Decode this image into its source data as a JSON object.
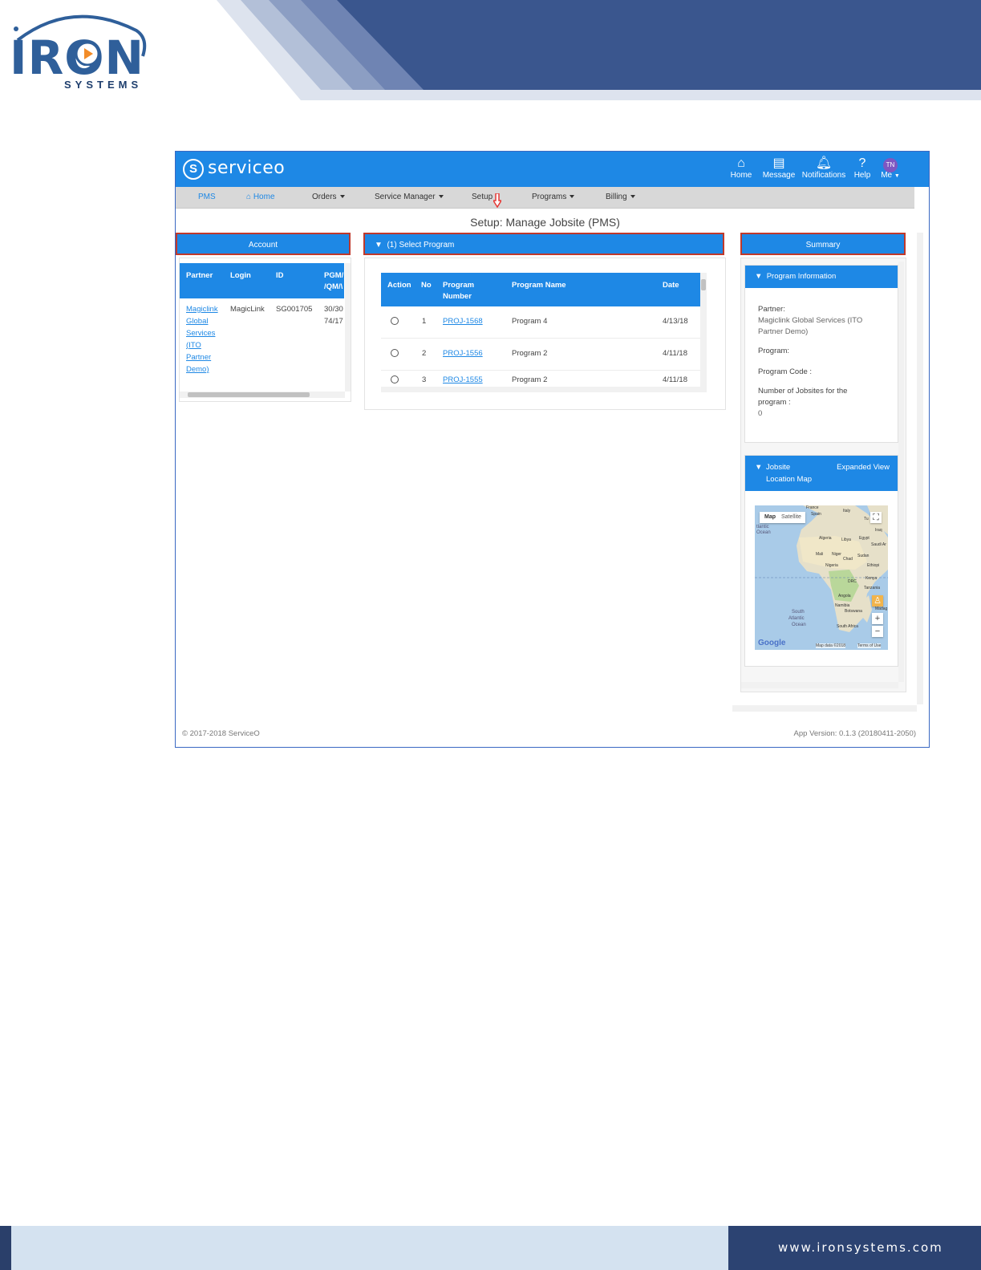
{
  "document": {
    "logo_text": "IRON",
    "logo_subtext": "SYSTEMS",
    "footer_url": "www.ironsystems.com",
    "colors": {
      "navy": "#2c4372",
      "brand_blue": "#1e88e5",
      "light_blue": "#d4e2f0"
    }
  },
  "topbar": {
    "brand": "serviceo",
    "items": [
      {
        "label": "Home",
        "icon": "home-icon"
      },
      {
        "label": "Message",
        "icon": "message-icon"
      },
      {
        "label": "Notifications",
        "icon": "bell-icon"
      },
      {
        "label": "Help",
        "icon": "help-icon"
      },
      {
        "label": "Me",
        "icon": "avatar",
        "initials": "TN"
      }
    ]
  },
  "nav": {
    "items": [
      "PMS",
      "Home",
      "Orders",
      "Service Manager",
      "Setup",
      "Programs",
      "Billing"
    ]
  },
  "page_title": "Setup: Manage Jobsite (PMS)",
  "account": {
    "header": "Account",
    "columns": [
      "Partner",
      "Login",
      "ID",
      "PGM/",
      "/QM/\\"
    ],
    "row": {
      "partner_lines": [
        "Magiclink",
        "Global",
        "Services",
        "(ITO",
        "Partner",
        "Demo)"
      ],
      "login": "MagicLink",
      "id": "SG001705",
      "pgm": [
        "30/30",
        "74/17"
      ]
    }
  },
  "program": {
    "header": "(1) Select Program",
    "columns": [
      "Action",
      "No",
      "Program",
      "Number",
      "Program Name",
      "Date"
    ],
    "rows": [
      {
        "no": "1",
        "number": "PROJ-1568",
        "name": "Program 4",
        "date": "4/13/18"
      },
      {
        "no": "2",
        "number": "PROJ-1556",
        "name": "Program 2",
        "date": "4/11/18"
      },
      {
        "no": "3",
        "number": "PROJ-1555",
        "name": "Program 2",
        "date": "4/11/18"
      }
    ]
  },
  "summary": {
    "header": "Summary",
    "program_info": {
      "title": "Program Information",
      "partner_label": "Partner:",
      "partner_value_1": "Magiclink Global Services (ITO",
      "partner_value_2": "Partner Demo)",
      "program_label": "Program:",
      "program_code_label": "Program Code :",
      "jobsites_label_1": "Number of Jobsites for the",
      "jobsites_label_2": "program :",
      "jobsites_value": "0"
    },
    "map_card": {
      "title_1": "Jobsite",
      "title_2": "Location Map",
      "expanded_view": "Expanded View",
      "tab_map": "Map",
      "tab_satellite": "Satellite",
      "google": "Google",
      "map_data": "Map data ©2018",
      "terms": "Terms of Use",
      "labels": {
        "france": "France",
        "spain": "Spain",
        "italy": "Italy",
        "tunisia": "Tu",
        "atlantic_1": "tlantic",
        "atlantic_2": "Ocean",
        "algeria": "Algeria",
        "libya": "Libya",
        "egypt": "Egypt",
        "iraq": "Iraq",
        "saudi": "Saudi Ar",
        "mali": "Mali",
        "niger": "Niger",
        "chad": "Chad",
        "sudan": "Sudan",
        "nigeria": "Nigeria",
        "ethiopia": "Ethiopi",
        "drc": "DRC",
        "kenya": "Kenya",
        "tanzania": "Tanzania",
        "angola": "Angola",
        "namibia": "Namibia",
        "botswana": "Botswana",
        "madag": "Madag",
        "south_africa": "South Africa",
        "south_atlantic_1": "South",
        "south_atlantic_2": "Atlantic",
        "south_atlantic_3": "Ocean"
      }
    }
  },
  "footer": {
    "copyright": "© 2017-2018 ServiceO",
    "version": "App Version: 0.1.3 (20180411-2050)"
  }
}
